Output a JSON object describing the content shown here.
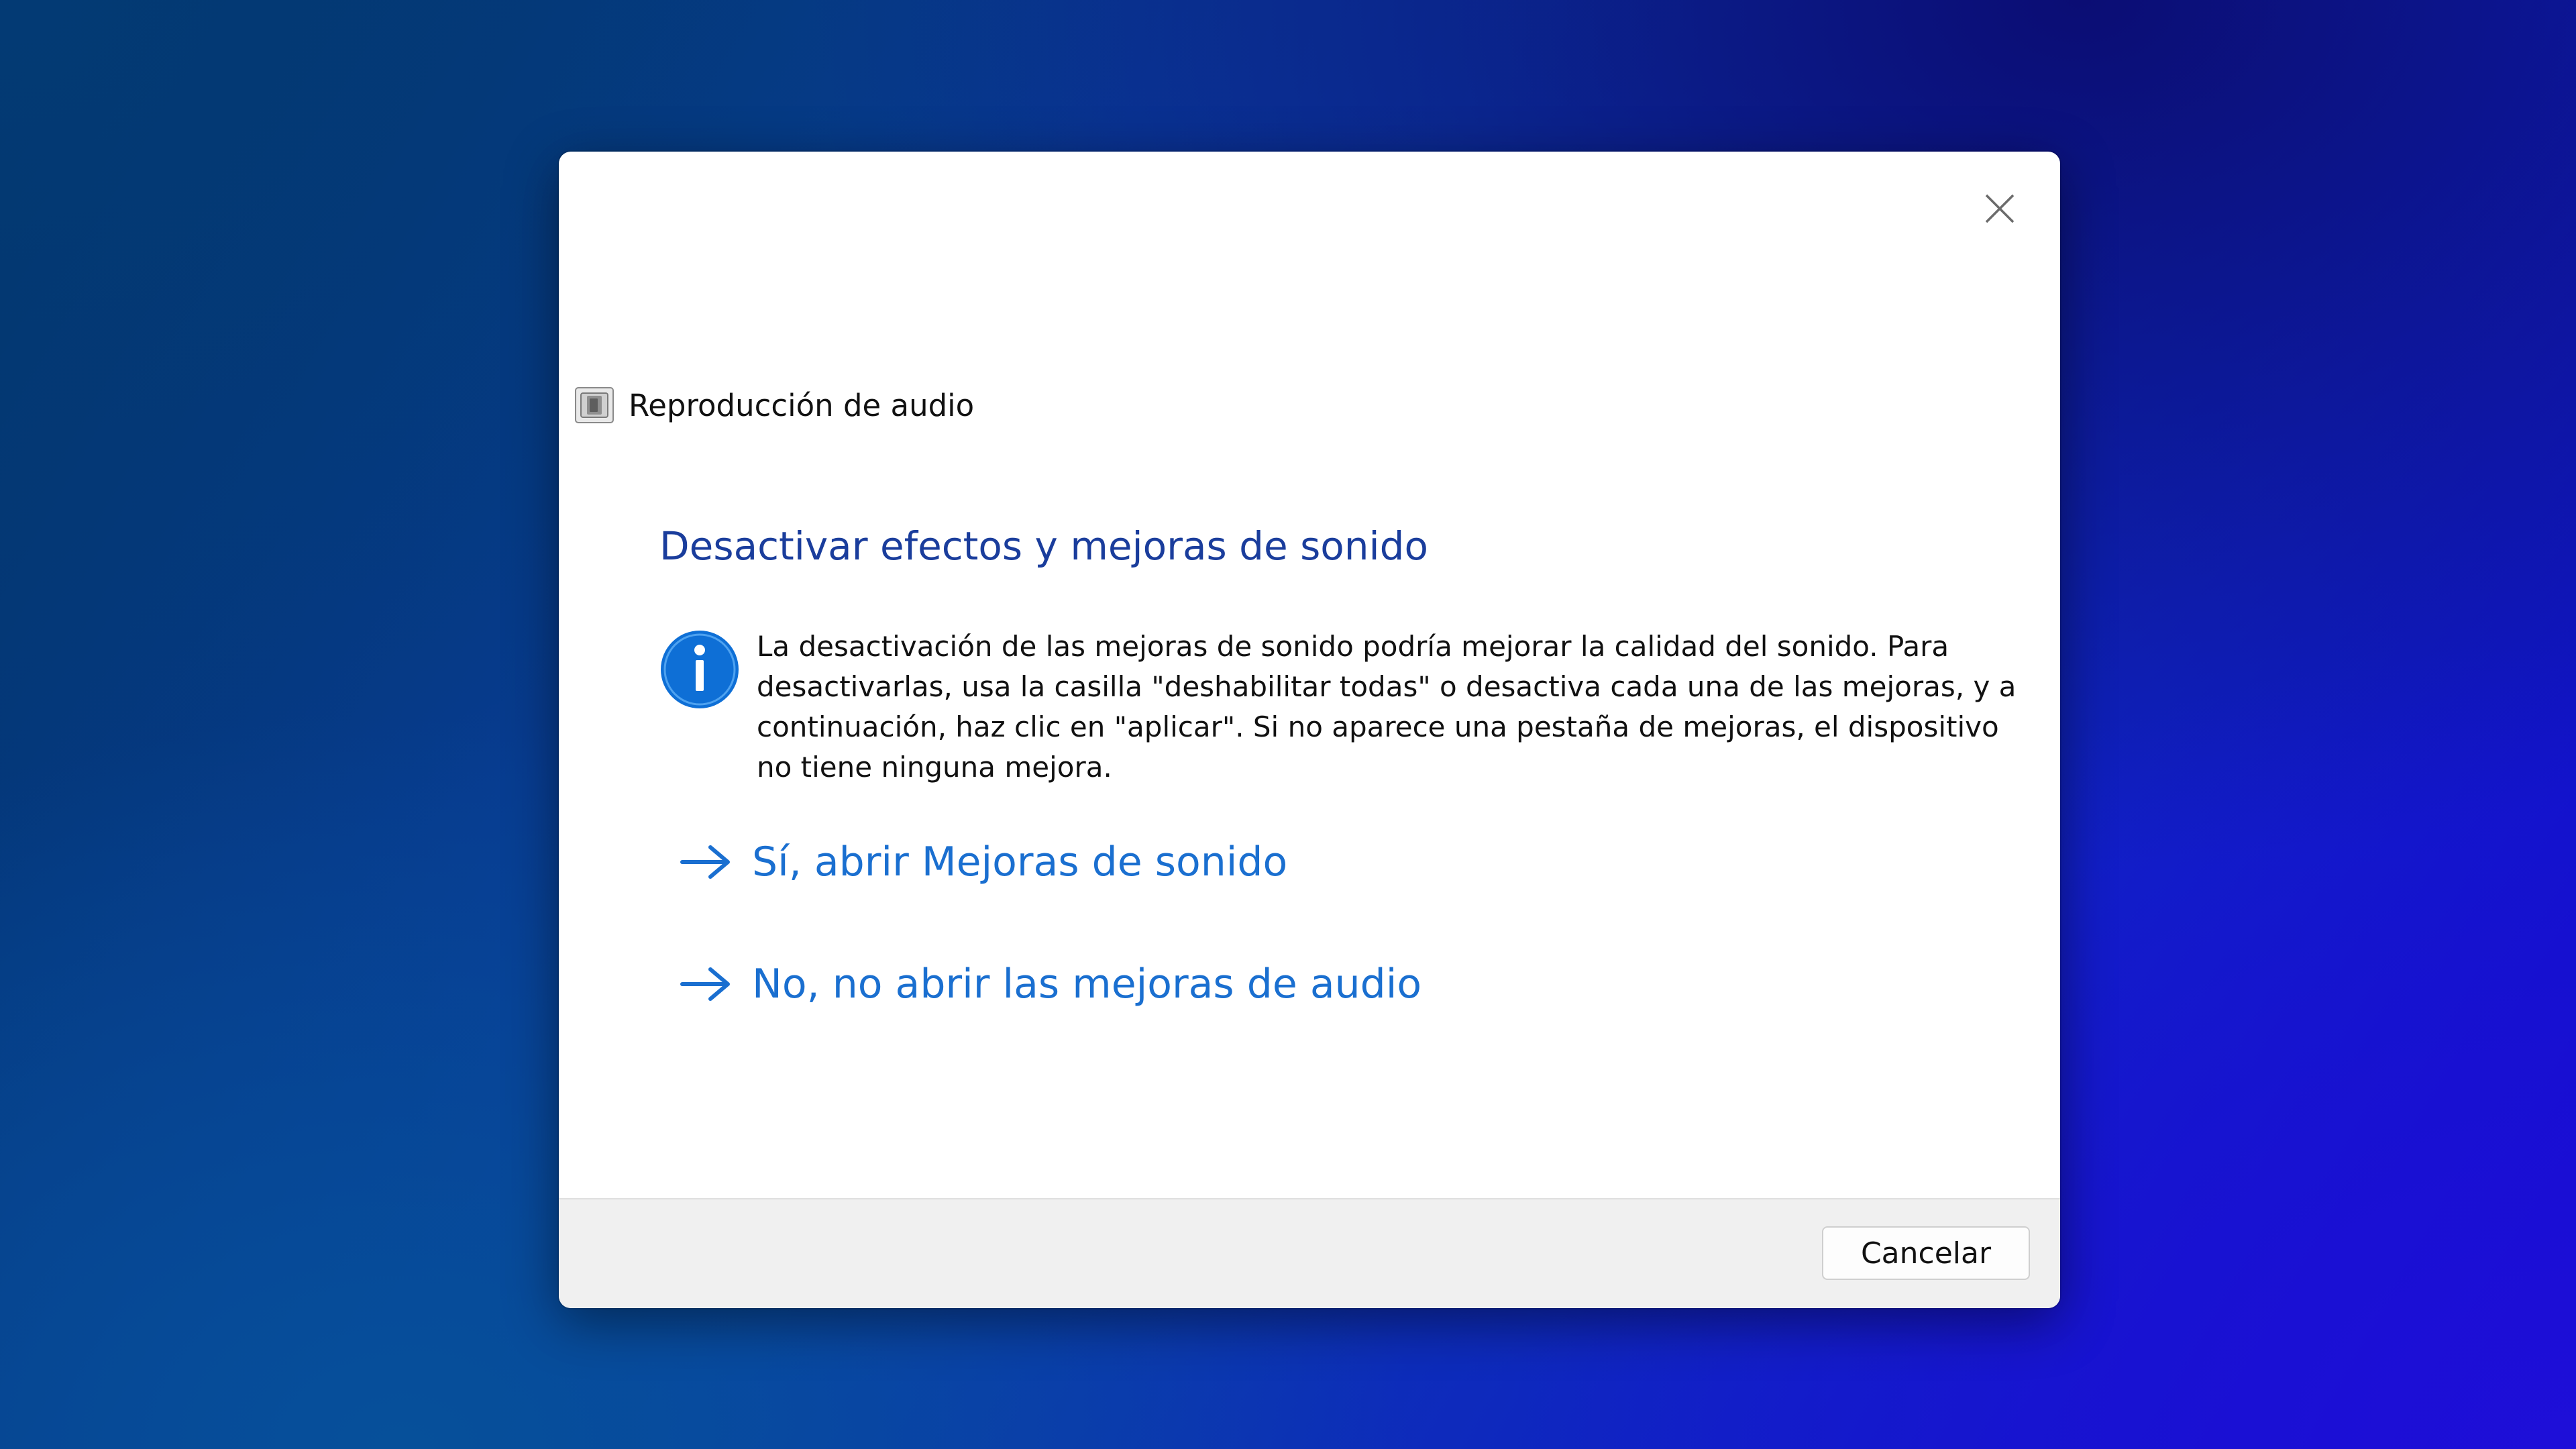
{
  "dialog": {
    "title": "Reproducción de audio",
    "heading": "Desactivar efectos y mejoras de sonido",
    "info_text": "La desactivación de las mejoras de sonido podría mejorar la calidad del sonido. Para desactivarlas, usa la casilla \"deshabilitar todas\" o desactiva cada una de las mejoras, y a continuación, haz clic en \"aplicar\". Si no aparece una pestaña de mejoras, el dispositivo no tiene ninguna mejora.",
    "links": [
      {
        "label": "Sí, abrir Mejoras de sonido",
        "icon": "arrow-right-icon"
      },
      {
        "label": "No, no abrir las mejoras de audio",
        "icon": "arrow-right-icon"
      }
    ],
    "cancel_label": "Cancelar",
    "icons": {
      "app": "audio-device-icon",
      "info": "info-icon",
      "close": "close-icon"
    }
  },
  "colors": {
    "heading": "#1a3d9c",
    "link": "#1a6fd0",
    "info_icon": "#0e6fd6",
    "footer": "#f0f0f0"
  }
}
